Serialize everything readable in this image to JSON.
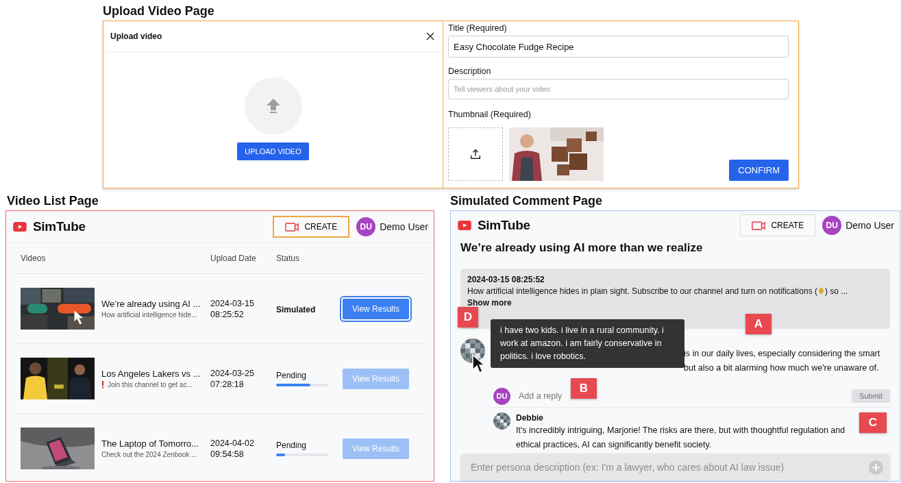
{
  "upload_page": {
    "caption": "Upload Video Page",
    "dialog": {
      "title": "Upload video",
      "upload_button": "UPLOAD VIDEO"
    },
    "form": {
      "title_label": "Title (Required)",
      "title_value": "Easy Chocolate Fudge Recipe",
      "description_label": "Description",
      "description_placeholder": "Tell viewers about your video",
      "thumbnail_label": "Thumbnail (Required)",
      "confirm_button": "CONFIRM"
    }
  },
  "video_list_page": {
    "caption": "Video List Page",
    "header": {
      "logo": "SimTube",
      "create_button": "CREATE",
      "create_highlighted": true,
      "avatar": "DU",
      "user": "Demo User"
    },
    "table": {
      "columns": [
        "Videos",
        "Upload Date",
        "Status"
      ],
      "rows": [
        {
          "title": "We’re already using AI ...",
          "subtitle": "How artificial intelligence hide...",
          "warning": false,
          "date": "2024-03-15",
          "time": "08:25:52",
          "kind": "simulated",
          "status": "Simulated",
          "button": "View Results",
          "disabled": false,
          "focused": true
        },
        {
          "title": "Los Angeles Lakers vs ...",
          "subtitle": "Join this channel to get ac...",
          "warning": true,
          "date": "2024-03-25",
          "time": "07:28:18",
          "kind": "pending",
          "status": "Pending",
          "level": 0.66,
          "button": "View Results",
          "disabled": true,
          "focused": false
        },
        {
          "title": "The Laptop of Tomorro...",
          "subtitle": "Check out the 2024 Zenbook ...",
          "warning": false,
          "date": "2024-04-02",
          "time": "09:54:58",
          "kind": "pending",
          "status": "Pending",
          "level": 0.17,
          "button": "View Results",
          "disabled": true,
          "focused": false
        }
      ]
    }
  },
  "comment_page": {
    "caption": "Simulated Comment Page",
    "header": {
      "logo": "SimTube",
      "create_button": "CREATE",
      "create_highlighted": false,
      "avatar": "DU",
      "user": "Demo User"
    },
    "video_title": "We’re already using AI more than we realize",
    "description_box": {
      "timestamp": "2024-03-15 08:25:52",
      "text_before_icon": "How artificial intelligence hides in plain sight. Subscribe to our channel and turn on notifications (",
      "text_after_icon": ") so ...",
      "show_more": "Show more"
    },
    "persona_tooltip": "i have two kids. i live in a rural community. i work at amazon. i am fairly conservative in politics. i love robotics.",
    "comment": {
      "visible_line_1": "is in our daily lives, especially considering the smart",
      "visible_line_2": "but also a bit alarming how much we're unaware of."
    },
    "reply_box": {
      "avatar": "DU",
      "placeholder": "Add a reply",
      "submit_button": "Submit",
      "submit_disabled": true
    },
    "replies": [
      {
        "author": "Debbie",
        "text": "It's incredibly intriguing, Marjorie! The risks are there, but with thoughtful regulation and ethical practices, AI can significantly benefit society."
      }
    ],
    "persona_input": {
      "placeholder": "Enter persona description (ex: I'm a lawyer, who cares about AI law issue)"
    },
    "callouts": [
      "A",
      "B",
      "C",
      "D"
    ]
  }
}
